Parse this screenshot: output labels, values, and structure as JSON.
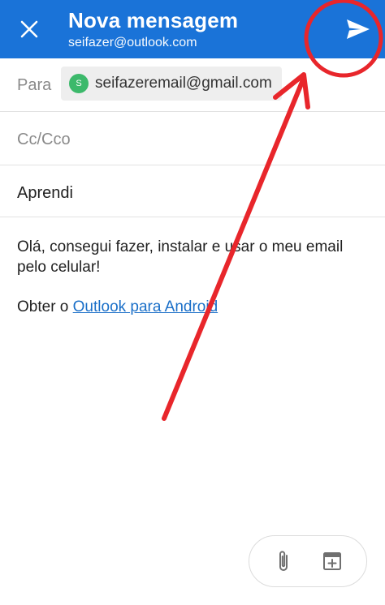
{
  "header": {
    "title": "Nova mensagem",
    "account": "seifazer@outlook.com",
    "background_color": "#1a73d8"
  },
  "to": {
    "label": "Para",
    "recipient": {
      "initial": "S",
      "email": "seifazeremail@gmail.com",
      "avatar_color": "#3cb96b"
    }
  },
  "cc": {
    "placeholder": "Cc/Cco"
  },
  "subject": {
    "value": "Aprendi"
  },
  "body": {
    "text": "Olá, consegui fazer, instalar e usar o meu email pelo celular!",
    "signature_prefix": "Obter o ",
    "signature_link": "Outlook para Android"
  },
  "toolbar": {
    "attach_icon": "paperclip-icon",
    "add_icon": "calendar-add-icon"
  },
  "annotation": {
    "color": "#e8262b"
  }
}
